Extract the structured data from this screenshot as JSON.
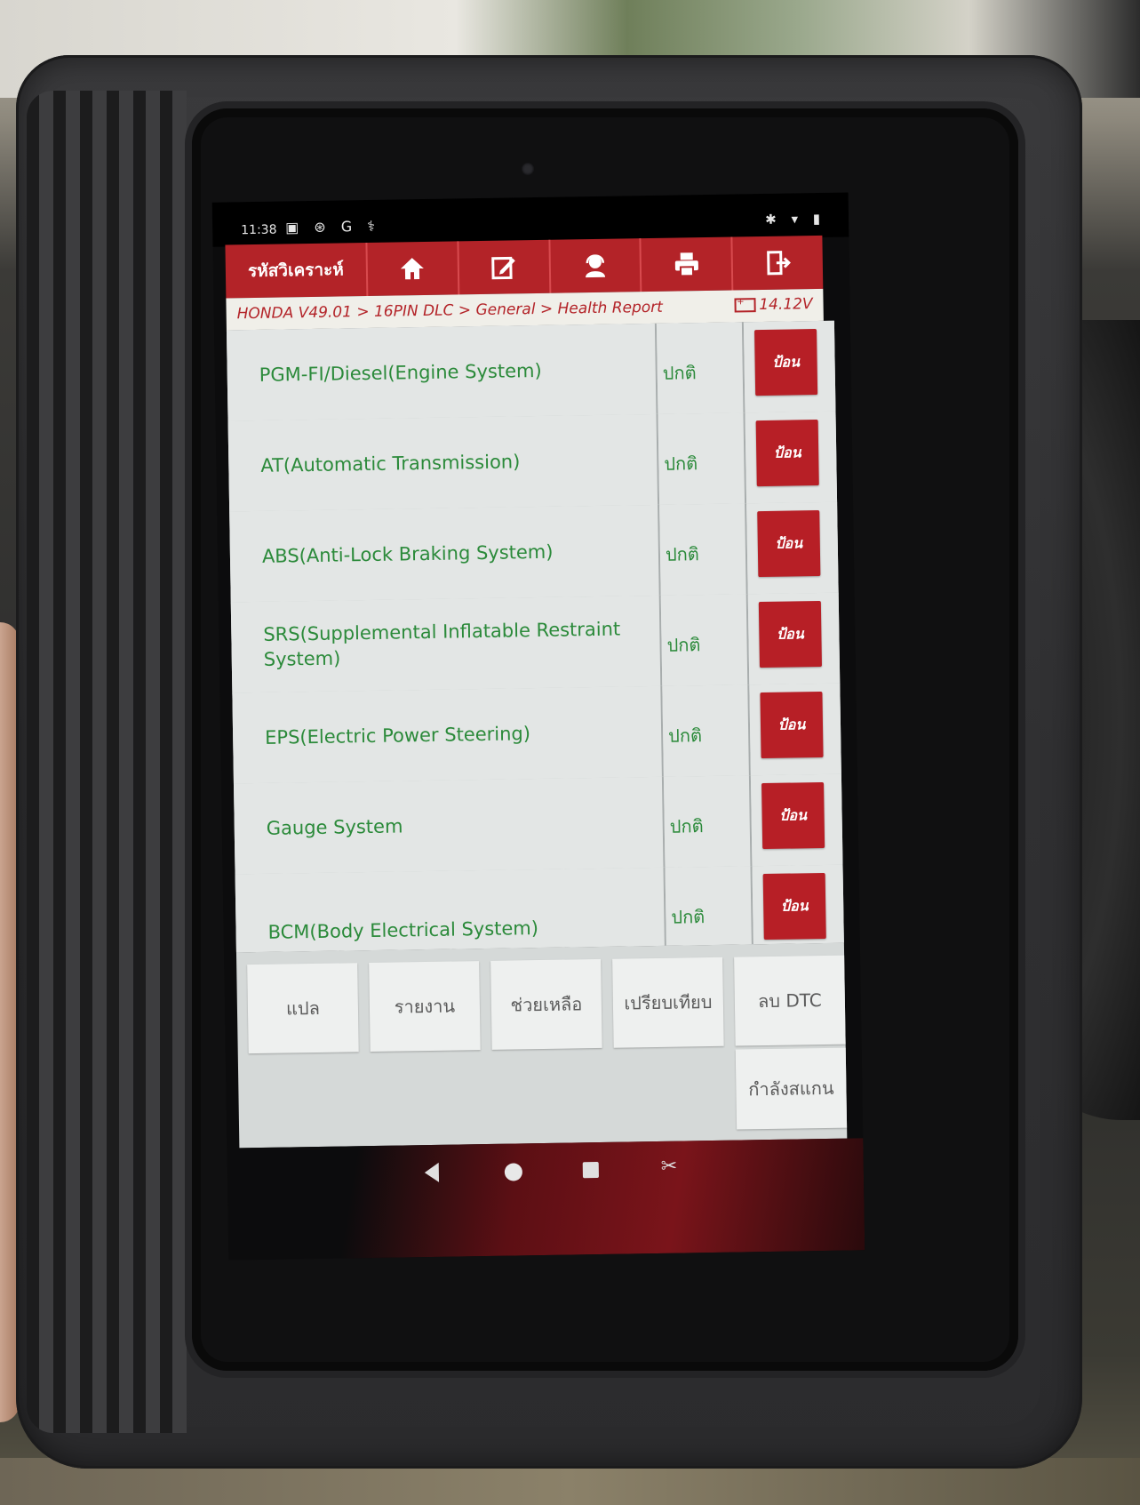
{
  "status_bar": {
    "time": "11:38"
  },
  "app_bar": {
    "title": "รหัสวิเคราะห์"
  },
  "breadcrumb": {
    "path": "HONDA V49.01 > 16PIN DLC > General > Health Report",
    "voltage": "14.12V"
  },
  "systems": [
    {
      "name": "PGM-FI/Diesel(Engine System)",
      "status": "ปกติ",
      "action": "ป้อน"
    },
    {
      "name": "AT(Automatic Transmission)",
      "status": "ปกติ",
      "action": "ป้อน"
    },
    {
      "name": "ABS(Anti-Lock Braking System)",
      "status": "ปกติ",
      "action": "ป้อน"
    },
    {
      "name": "SRS(Supplemental Inflatable Restraint System)",
      "status": "ปกติ",
      "action": "ป้อน"
    },
    {
      "name": "EPS(Electric Power Steering)",
      "status": "ปกติ",
      "action": "ป้อน"
    },
    {
      "name": "Gauge System",
      "status": "ปกติ",
      "action": "ป้อน"
    },
    {
      "name": "BCM(Body Electrical System)",
      "status": "ปกติ",
      "action": "ป้อน"
    }
  ],
  "footer": {
    "translate": "แปล",
    "report": "รายงาน",
    "help": "ช่วยเหลือ",
    "compare": "เปรียบเทียบ",
    "clear_dtc": "ลบ DTC",
    "scanning": "กำลังสแกน"
  },
  "colors": {
    "accent": "#b32328",
    "text_green": "#2b8a3a",
    "list_bg": "#e3e6e5"
  },
  "icons": [
    "home-icon",
    "edit-icon",
    "support-icon",
    "print-icon",
    "exit-icon"
  ]
}
